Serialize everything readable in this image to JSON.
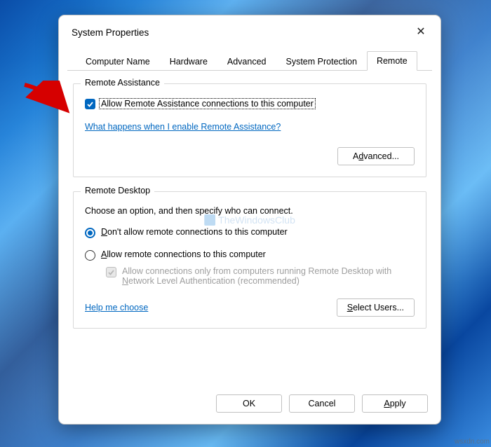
{
  "dialog": {
    "title": "System Properties",
    "close": "✕"
  },
  "tabs": {
    "items": [
      {
        "label": "Computer Name"
      },
      {
        "label": "Hardware"
      },
      {
        "label": "Advanced"
      },
      {
        "label": "System Protection"
      },
      {
        "label": "Remote"
      }
    ],
    "active": "Remote"
  },
  "remote_assistance": {
    "legend": "Remote Assistance",
    "allow_label": "Allow Remote Assistance connections to this computer",
    "allow_checked": true,
    "info_link": "What happens when I enable Remote Assistance?",
    "advanced_btn": "Advanced..."
  },
  "remote_desktop": {
    "legend": "Remote Desktop",
    "instruction": "Choose an option, and then specify who can connect.",
    "opt_dont_pre": "D",
    "opt_dont_post": "on't allow remote connections to this computer",
    "opt_allow_pre": "A",
    "opt_allow_post": "llow remote connections to this computer",
    "selected": "dont",
    "nla_pre": "Allow connections only from computers running Remote Desktop with ",
    "nla_key": "N",
    "nla_post": "etwork Level Authentication (recommended)",
    "nla_enabled": false,
    "help_link": "Help me choose",
    "select_users_pre": "S",
    "select_users_post": "elect Users..."
  },
  "buttons": {
    "ok": "OK",
    "cancel": "Cancel",
    "apply_pre": "A",
    "apply_post": "pply"
  },
  "watermark": "TheWindowsClub",
  "footer_tag": "wsxdn.com"
}
